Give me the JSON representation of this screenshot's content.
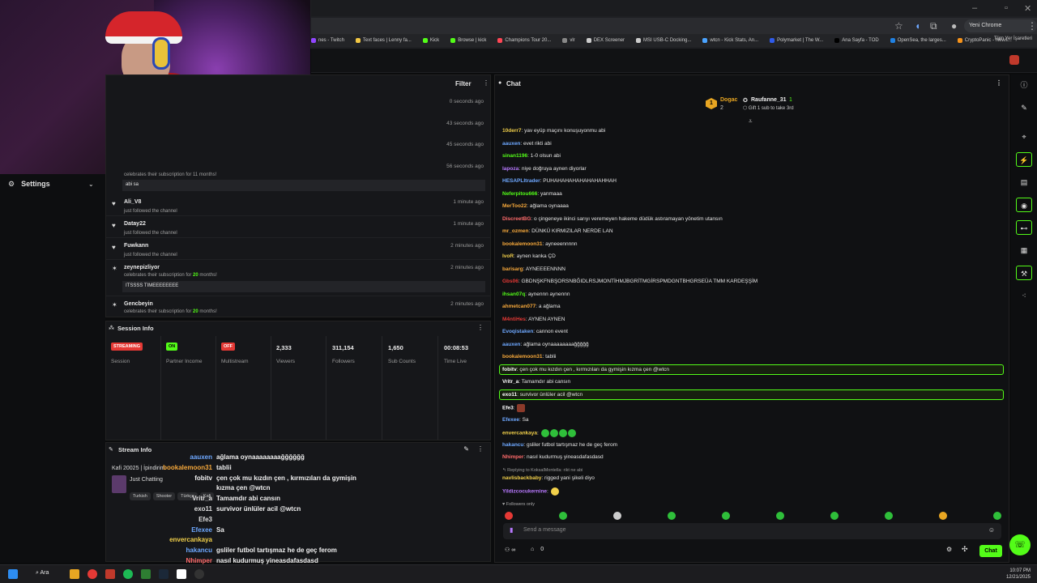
{
  "window_controls": {
    "minimize": "–",
    "maximize": "▫",
    "close": "✕"
  },
  "browser": {
    "chrome_pill": "Yeni Chrome kullanılabilir",
    "bookmarks": [
      {
        "label": "nes - Twitch",
        "color": "#9146ff"
      },
      {
        "label": "Text faces | Lenny fa...",
        "color": "#f2c744"
      },
      {
        "label": "Kick",
        "color": "#53fc18"
      },
      {
        "label": "Browse | kick",
        "color": "#53fc18"
      },
      {
        "label": "Champions Tour 20...",
        "color": "#ff4655"
      },
      {
        "label": "vlr",
        "color": "#888888"
      },
      {
        "label": "DEX Screener",
        "color": "#cccccc"
      },
      {
        "label": "MSI USB-C Docking...",
        "color": "#cccccc"
      },
      {
        "label": "wtcn - Kick Stats, An...",
        "color": "#4aa3ff"
      },
      {
        "label": "Polymarket | The W...",
        "color": "#2f5bea"
      },
      {
        "label": "Ana Sayfa - TOD",
        "color": "#000000"
      },
      {
        "label": "OpenSea, the larges...",
        "color": "#2081e2"
      },
      {
        "label": "CryptoPanic - News...",
        "color": "#f7931a"
      }
    ],
    "all_bookmarks": "Tüm Yer İşaretleri"
  },
  "sidebar": {
    "settings_label": "Settings"
  },
  "activity": {
    "filter_label": "Filter",
    "top_times": [
      "0 seconds ago",
      "43 seconds ago",
      "45 seconds ago",
      "56 seconds ago"
    ],
    "partial_text": "celebrates their subscription for 11 months!",
    "first_msg": "abi sa",
    "items": [
      {
        "name": "Ali_V8",
        "sub": "just followed the channel",
        "time": "1 minute ago"
      },
      {
        "name": "Datay22",
        "sub": "just followed the channel",
        "time": "1 minute ago"
      },
      {
        "name": "Fuwkann",
        "sub": "just followed the channel",
        "time": "2 minutes ago"
      },
      {
        "name": "zeynepizliyor",
        "sub_pre": "celebrates their subscription for ",
        "months": "20",
        "sub_post": " months!",
        "time": "2 minutes ago",
        "msg": "ITSSSS TIMEEEEEEEE"
      },
      {
        "name": "Gencbeyin",
        "sub_pre": "celebrates their subscription for ",
        "months": "20",
        "sub_post": " months!",
        "time": "2 minutes ago"
      }
    ]
  },
  "session": {
    "title": "Session Info",
    "cols": [
      {
        "badge": "STREAMING",
        "badge_color": "#e53935",
        "label": "Session"
      },
      {
        "badge": "ON",
        "badge_color": "#53fc18",
        "label": "Partner Income"
      },
      {
        "badge": "OFF",
        "badge_color": "#e53935",
        "label": "Multistream"
      },
      {
        "value": "2,333",
        "label": "Viewers"
      },
      {
        "value": "311,154",
        "label": "Followers"
      },
      {
        "value": "1,650",
        "label": "Sub Counts"
      },
      {
        "value": "00:08:53",
        "label": "Time Live"
      }
    ]
  },
  "stream_info": {
    "title": "Stream Info",
    "stream_title": "Kafi 20025 | İpindirim",
    "category": "Just Chatting",
    "tags": [
      "Turkish",
      "Shooter",
      "Türkçe",
      "Kafi"
    ]
  },
  "overlay_chat": [
    {
      "user": "aauxen",
      "color": "#6ea8ff",
      "msg": "ağlama oynaaaaaaaağğğğğğ"
    },
    {
      "user": "bookalemoon31",
      "color": "#f7a93b",
      "msg": "tablii"
    },
    {
      "user": "fobitv",
      "color": "#f0f0f0",
      "msg": "çen çok mu kızdın çen , kırmızıları da gymişin"
    },
    {
      "user": "",
      "color": "#f0f0f0",
      "msg": "kızma çen @wtcn"
    },
    {
      "user": "Vritr_a",
      "color": "#e0e0e0",
      "msg": "Tamamdır abi cansın"
    },
    {
      "user": "exo11",
      "color": "#e0e0e0",
      "msg": "survivor ünlüler acil @wtcn"
    },
    {
      "user": "Efe3",
      "color": "#e0e0e0",
      "msg": ""
    },
    {
      "user": "Efexee",
      "color": "#6ea8ff",
      "msg": "Sa"
    },
    {
      "user": "envercankaya",
      "color": "#f2d04a",
      "msg": ""
    },
    {
      "user": "hakancu",
      "color": "#6ea8ff",
      "msg": "gsliler futbol tartışmaz he de geç ferom"
    },
    {
      "user": "Nhimper",
      "color": "#ff6b6b",
      "msg": "nasıl kudurmuş yineasdafasdasd"
    },
    {
      "user": "Yildizcocukernine",
      "color": "#b879ff",
      "msg": ""
    }
  ],
  "chat": {
    "title": "Chat",
    "leader1": {
      "rank": "1",
      "name": "Dogac",
      "count": "2"
    },
    "leader2": {
      "name": "Raufanne_31",
      "count": "1",
      "note": "Gift 1 sub to take 3rd"
    },
    "messages": [
      {
        "user": "10derr7",
        "color": "#f2d04a",
        "msg": "yav eyüp maçını konuşuyonmu abi"
      },
      {
        "user": "aauxen",
        "color": "#6ea8ff",
        "msg": "evet rikti abi"
      },
      {
        "user": "sinan1196",
        "color": "#53fc18",
        "msg": "1-0 olsun abi"
      },
      {
        "user": "lapoza",
        "color": "#b879ff",
        "msg": "niye doğruya aynen diyorlar"
      },
      {
        "user": "HESAPLItrader",
        "color": "#6ea8ff",
        "msg": "PUHAHAHAHAHAHAHAHHAH"
      },
      {
        "user": "Neferpitou666",
        "color": "#53fc18",
        "msg": "yanmaaa"
      },
      {
        "user": "MerToo22",
        "color": "#f7a93b",
        "msg": "ağlama oynaaaa"
      },
      {
        "user": "DiscreetBG",
        "color": "#ff6b6b",
        "msg": "o çingeneye ikinci sarıyı veremeyen hakeme düdük astıramayan yönetim utansın"
      },
      {
        "user": "mr_ozmen",
        "color": "#f7a93b",
        "msg": "DÜNKÜ KIRMIZILAR NERDE LAN"
      },
      {
        "user": "bookalemoon31",
        "color": "#f7a93b",
        "msg": "ayneeennnnn"
      },
      {
        "user": "lvoR",
        "color": "#f2d04a",
        "msg": "aynen kanka ÇD"
      },
      {
        "user": "barisarg",
        "color": "#f7a93b",
        "msg": "AYNEEEENNNN"
      },
      {
        "user": "Gbs06",
        "color": "#e53935",
        "msg": "GBDNŞKFNBŞORSNBĞIDLRSJMONTİHMJBGRİTMGİRSPMDGNTBHGRSEÜA TMM KARDEŞŞİM"
      },
      {
        "user": "ihsan07q",
        "color": "#53fc18",
        "msg": "aynennn aynennn"
      },
      {
        "user": "ahmetcan077",
        "color": "#f7a93b",
        "msg": "a ağlama"
      },
      {
        "user": "M4ntiHes",
        "color": "#e53935",
        "msg": "AYNEN AYNEN"
      },
      {
        "user": "Evoqistaken",
        "color": "#6ea8ff",
        "msg": "cannon event"
      },
      {
        "user": "aauxen",
        "color": "#6ea8ff",
        "msg": "ağlama oynaaaaaaaağğğğğ"
      },
      {
        "user": "bookalemoon31",
        "color": "#f7a93b",
        "msg": "tablii"
      },
      {
        "user": "fobitv",
        "color": "#ffffff",
        "msg": "çen çok mu kızdın çen , kırmızıları da gymişin kızma çen @wtcn",
        "hl": true
      },
      {
        "user": "Vritr_a",
        "color": "#ffffff",
        "msg": "Tamamdır abi cansın"
      },
      {
        "user": "exo11",
        "color": "#ffffff",
        "msg": "survivor ünlüler acil @wtcn",
        "hl": true
      },
      {
        "user": "Efe3",
        "color": "#ffffff",
        "msg": ""
      },
      {
        "user": "Efexee",
        "color": "#6ea8ff",
        "msg": "Sa"
      },
      {
        "user": "envercankaya",
        "color": "#f2d04a",
        "msg": ""
      },
      {
        "user": "hakancu",
        "color": "#6ea8ff",
        "msg": "gsliler futbol tartışmaz he de geç ferom"
      },
      {
        "user": "Nhimper",
        "color": "#ff6b6b",
        "msg": "nasıl kudurmuş yineasdafasdasd"
      }
    ],
    "reply_to": "Replying to KoksalMontella: rikt ne abi",
    "reply_user": "navlisbackbaby",
    "reply_msg": "rigged yani şikeli diyo",
    "last_user": "Yildizcocukernine",
    "followers_only": "Followers only",
    "input_placeholder": "Send a message",
    "viewer_count": "∞",
    "store_count": "0",
    "send_label": "Chat"
  },
  "taskbar": {
    "search_label": "Ara",
    "time": "10:07 PM",
    "date": "12/21/2025"
  }
}
